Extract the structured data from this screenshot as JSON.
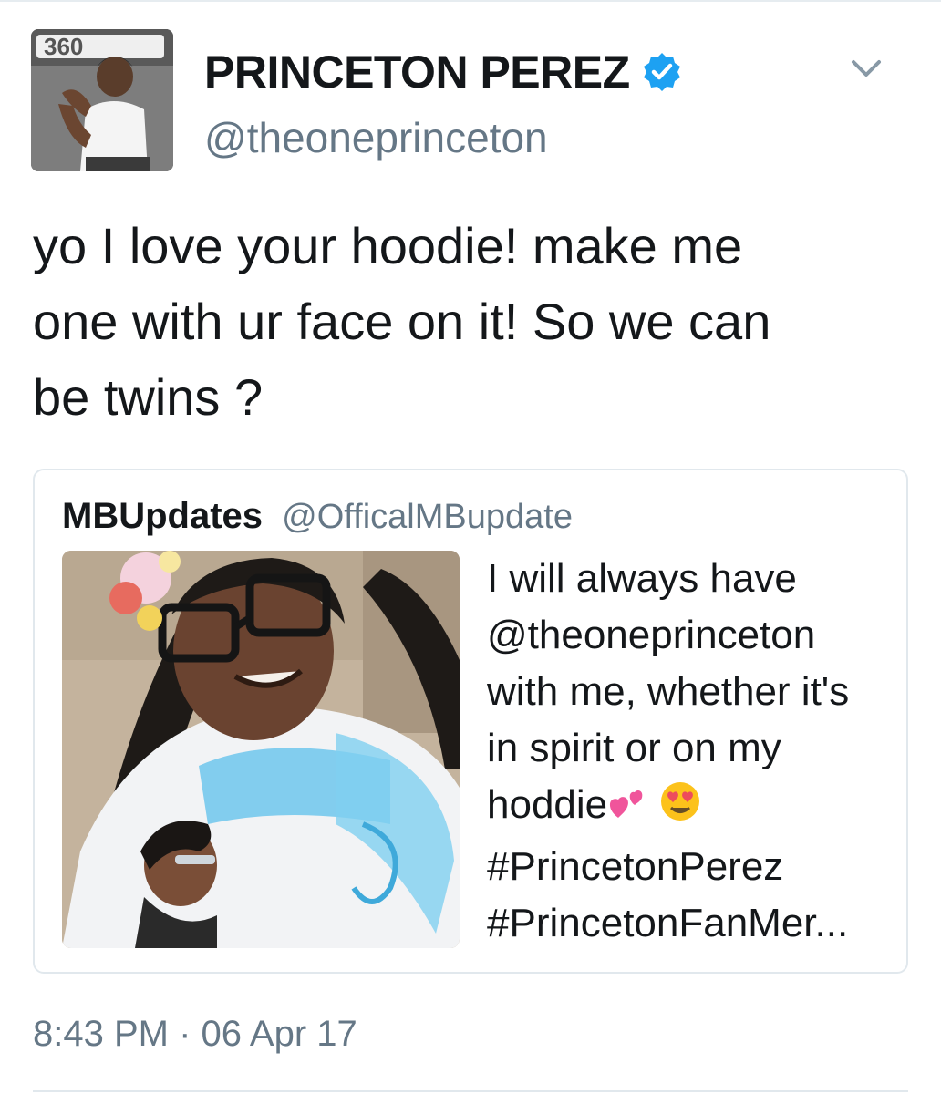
{
  "tweet": {
    "author": {
      "display_name": "PRINCETON PEREZ",
      "handle": "@theoneprinceton",
      "verified": true,
      "avatar_badge": "360"
    },
    "text": "yo I love your hoodie! make me\none with ur face on it! So we can\nbe twins ?",
    "timestamp": "8:43 PM · 06 Apr 17",
    "quoted": {
      "display_name": "MBUpdates",
      "handle": "@OfficalMBupdate",
      "text_lines": [
        "I will always have",
        "@theoneprinceton",
        "with me, whether it's",
        "in spirit or on my",
        "hoddie",
        "#PrincetonPerez",
        "#PrincetonFanMer..."
      ]
    }
  },
  "icons": {
    "verified": "verified-badge-icon",
    "caret": "chevron-down-icon",
    "emoji_hearts": "two-hearts-emoji",
    "emoji_heart_eyes": "heart-eyes-emoji"
  },
  "colors": {
    "primary_text": "#14171a",
    "secondary_text": "#657786",
    "verified_blue": "#1da1f2",
    "border": "#e1e8ed"
  }
}
